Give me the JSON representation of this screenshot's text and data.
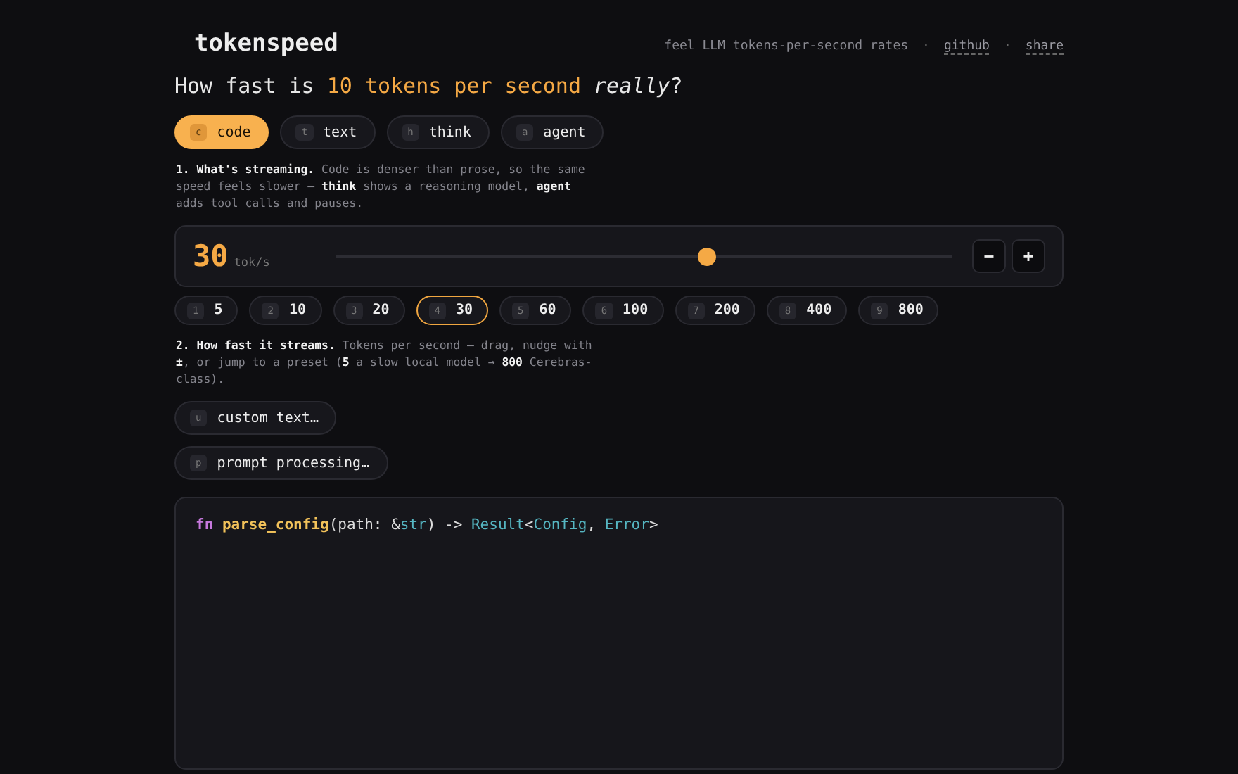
{
  "brand": "tokenspeed",
  "nav": [
    {
      "kind": "text",
      "label": "feel LLM tokens-per-second rates"
    },
    {
      "kind": "sep",
      "label": "·"
    },
    {
      "kind": "link",
      "label": "github"
    },
    {
      "kind": "sep",
      "label": "·"
    },
    {
      "kind": "link",
      "label": "share"
    }
  ],
  "headline": [
    {
      "kind": "plain",
      "text": "How fast is "
    },
    {
      "kind": "accent",
      "text": "10 tokens per second"
    },
    {
      "kind": "italic",
      "text": " really"
    },
    {
      "kind": "plain",
      "text": "?"
    }
  ],
  "modes": [
    {
      "key": "c",
      "label": "code",
      "selected": true
    },
    {
      "key": "t",
      "label": "text",
      "selected": false
    },
    {
      "key": "h",
      "label": "think",
      "selected": false
    },
    {
      "key": "a",
      "label": "agent",
      "selected": false
    }
  ],
  "mode_note": "**1. What's streaming.** Code is denser than prose, so the same speed feels slower — **think** shows a reasoning model, **agent** adds tool calls and pauses.",
  "speed": {
    "value": "30",
    "unit": "tok/s",
    "level": 0.6,
    "minus": "−",
    "plus": "+"
  },
  "presets": [
    {
      "key": "1",
      "label": "5",
      "selected": false
    },
    {
      "key": "2",
      "label": "10",
      "selected": false
    },
    {
      "key": "3",
      "label": "20",
      "selected": false
    },
    {
      "key": "4",
      "label": "30",
      "selected": true
    },
    {
      "key": "5",
      "label": "60",
      "selected": false
    },
    {
      "key": "6",
      "label": "100",
      "selected": false
    },
    {
      "key": "7",
      "label": "200",
      "selected": false
    },
    {
      "key": "8",
      "label": "400",
      "selected": false
    },
    {
      "key": "9",
      "label": "800",
      "selected": false
    }
  ],
  "speed_note": "**2. How fast it streams.** Tokens per second — drag, nudge with **±**, or jump to a preset (**5** a slow local model → **800** Cerebras-class).",
  "actions": [
    {
      "key": "u",
      "label": "custom text…"
    },
    {
      "key": "p",
      "label": "prompt processing…"
    }
  ],
  "code_line": [
    {
      "kind": "keyword",
      "text": "fn "
    },
    {
      "kind": "function",
      "text": "parse_config"
    },
    {
      "kind": "plain",
      "text": "(path: &"
    },
    {
      "kind": "type",
      "text": "str"
    },
    {
      "kind": "plain",
      "text": ") -> "
    },
    {
      "kind": "type",
      "text": "Result"
    },
    {
      "kind": "plain",
      "text": "<"
    },
    {
      "kind": "type",
      "text": "Config"
    },
    {
      "kind": "plain",
      "text": ", "
    },
    {
      "kind": "type",
      "text": "Error"
    },
    {
      "kind": "plain",
      "text": ">"
    }
  ]
}
